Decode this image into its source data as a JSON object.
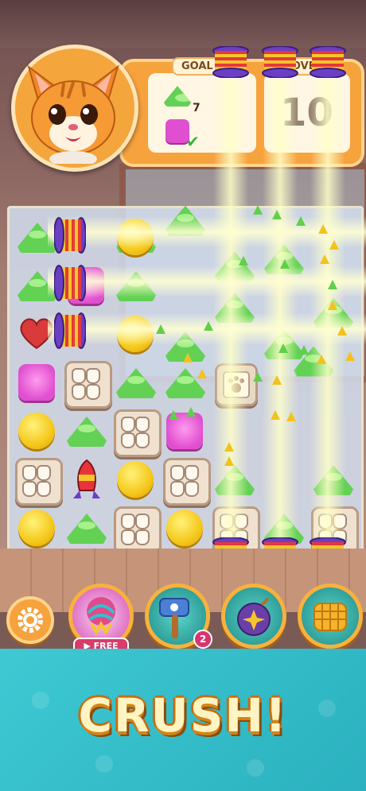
{
  "header": {
    "goal_title": "GOAL",
    "moves_title": "MOVES",
    "goals": [
      {
        "icon": "green-gem-icon",
        "count": "7"
      },
      {
        "icon": "pink-gem-icon",
        "status": "done"
      }
    ],
    "moves_value": "10"
  },
  "boosters": {
    "settings_icon": "gear-icon",
    "items": [
      {
        "name": "yarn-ball",
        "tag": "FREE"
      },
      {
        "name": "hammer",
        "badge": "2"
      },
      {
        "name": "bomb"
      },
      {
        "name": "fish-basket"
      }
    ]
  },
  "banner": {
    "text": "CRUSH!"
  },
  "colors": {
    "panel": "#f6a23d",
    "teal": "#3ec9d3",
    "green_gem": "#62d154",
    "yellow_gem": "#f5c81b",
    "pink_gem": "#e04fcf"
  }
}
